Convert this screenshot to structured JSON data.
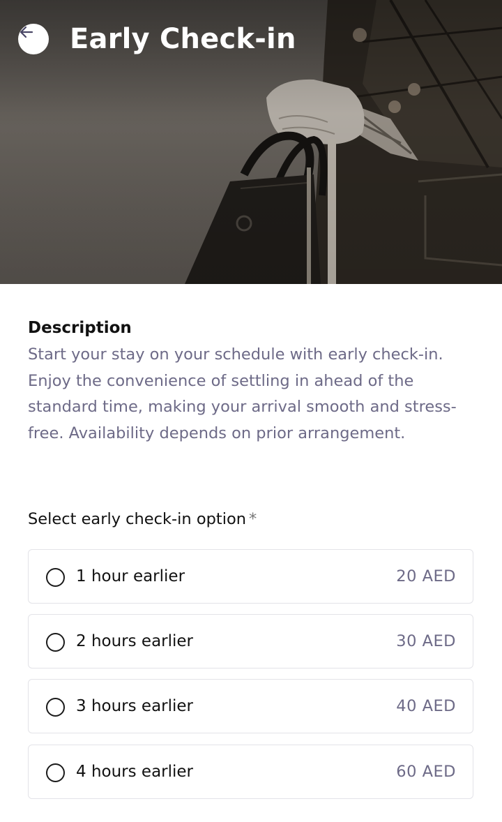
{
  "header": {
    "title": "Early Check-in",
    "back_icon": "arrow-left-icon",
    "hero_image": "person-holding-handbag-photo"
  },
  "description": {
    "heading": "Description",
    "text": "Start your stay on your schedule with early check-in. Enjoy the convenience of settling in ahead of the standard time, making your arrival smooth and stress-free. Availability depends on prior arrangement."
  },
  "selection": {
    "label": "Select early check-in option",
    "required_mark": "*",
    "options": [
      {
        "label": "1 hour earlier",
        "price": "20 AED",
        "selected": false
      },
      {
        "label": "2 hours earlier",
        "price": "30 AED",
        "selected": false
      },
      {
        "label": "3 hours earlier",
        "price": "40 AED",
        "selected": false
      },
      {
        "label": "4 hours earlier",
        "price": "60 AED",
        "selected": false
      }
    ]
  },
  "colors": {
    "accent_text": "#6d6a87",
    "border": "#e3e3e8",
    "title": "#ffffff"
  }
}
